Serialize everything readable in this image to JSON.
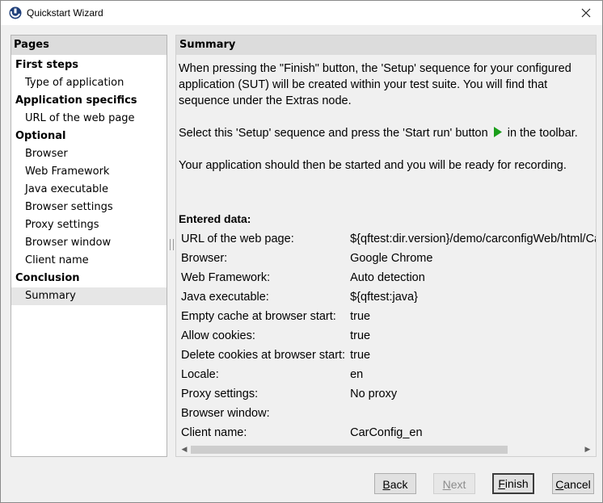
{
  "window": {
    "title": "Quickstart Wizard"
  },
  "pages": {
    "header": "Pages",
    "items": [
      {
        "label": "First steps",
        "kind": "group"
      },
      {
        "label": "Type of application",
        "kind": "sub"
      },
      {
        "label": "Application specifics",
        "kind": "group"
      },
      {
        "label": "URL of the web page",
        "kind": "sub"
      },
      {
        "label": "Optional",
        "kind": "group"
      },
      {
        "label": "Browser",
        "kind": "sub"
      },
      {
        "label": "Web Framework",
        "kind": "sub"
      },
      {
        "label": "Java executable",
        "kind": "sub"
      },
      {
        "label": "Browser settings",
        "kind": "sub"
      },
      {
        "label": "Proxy settings",
        "kind": "sub"
      },
      {
        "label": "Browser window",
        "kind": "sub"
      },
      {
        "label": "Client name",
        "kind": "sub"
      },
      {
        "label": "Conclusion",
        "kind": "group"
      },
      {
        "label": "Summary",
        "kind": "sub",
        "selected": true
      }
    ]
  },
  "summary": {
    "header": "Summary",
    "para1_line1": "When pressing the \"Finish\" button, the 'Setup' sequence for your configured",
    "para1_line2": "application (SUT) will be created within your test suite. You will find that",
    "para1_line3": "sequence under the Extras node.",
    "para2_before": "Select this 'Setup' sequence and press the 'Start run' button",
    "para2_after": "in the toolbar.",
    "para3": "Your application should then be started and you will be ready for recording.",
    "entered_title": "Entered data:",
    "rows": [
      {
        "key": "URL of the web page:",
        "value": "${qftest:dir.version}/demo/carconfigWeb/html/CarConfig_en.html"
      },
      {
        "key": "Browser:",
        "value": "Google Chrome"
      },
      {
        "key": "Web Framework:",
        "value": "Auto detection"
      },
      {
        "key": "Java executable:",
        "value": "${qftest:java}"
      },
      {
        "key": "Empty cache at browser start:",
        "value": "true"
      },
      {
        "key": "Allow cookies:",
        "value": "true"
      },
      {
        "key": "Delete cookies at browser start:",
        "value": "true"
      },
      {
        "key": "Locale:",
        "value": "en"
      },
      {
        "key": "Proxy settings:",
        "value": "No proxy"
      },
      {
        "key": "Browser window:",
        "value": ""
      },
      {
        "key": "Client name:",
        "value": "CarConfig_en"
      }
    ]
  },
  "buttons": {
    "back": "Back",
    "next": "Next",
    "finish": "Finish",
    "cancel": "Cancel"
  },
  "colors": {
    "play_icon": "#1a9e1a",
    "app_icon": "#1f3f7a"
  }
}
